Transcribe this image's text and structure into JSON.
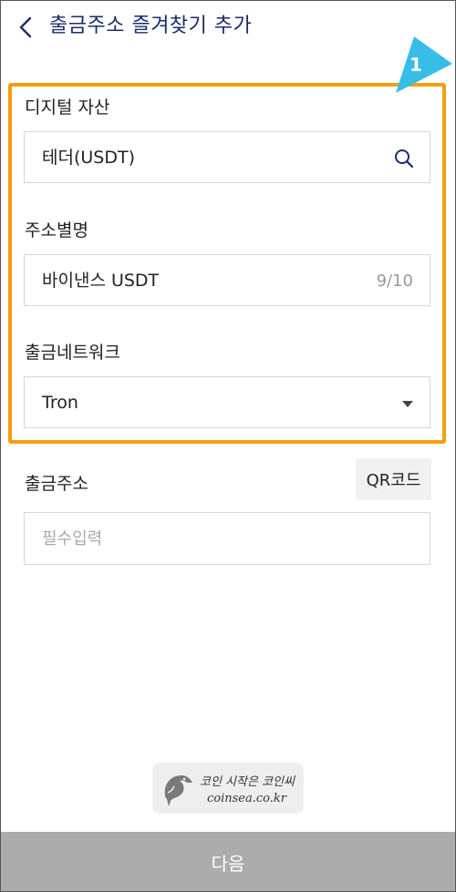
{
  "header": {
    "title": "출금주소 즐겨찾기 추가",
    "back_icon": "chevron-left-icon"
  },
  "form": {
    "asset": {
      "label": "디지털 자산",
      "value": "테더(USDT)",
      "icon": "search-icon"
    },
    "alias": {
      "label": "주소별명",
      "value": "바이낸스 USDT",
      "counter": "9/10"
    },
    "network": {
      "label": "출금네트워크",
      "value": "Tron",
      "icon": "caret-down-icon"
    },
    "address": {
      "label": "출금주소",
      "qr_label": "QR코드",
      "placeholder": "필수입력"
    }
  },
  "annotation": {
    "step_number": "1",
    "highlight_color": "#f59e0b",
    "callout_color": "#38bde8"
  },
  "watermark": {
    "line1": "코인 시작은 코인씨",
    "line2": "coinsea.co.kr"
  },
  "footer": {
    "next_label": "다음"
  },
  "colors": {
    "title": "#1b2c6b",
    "next_button_bg": "#acacac"
  }
}
